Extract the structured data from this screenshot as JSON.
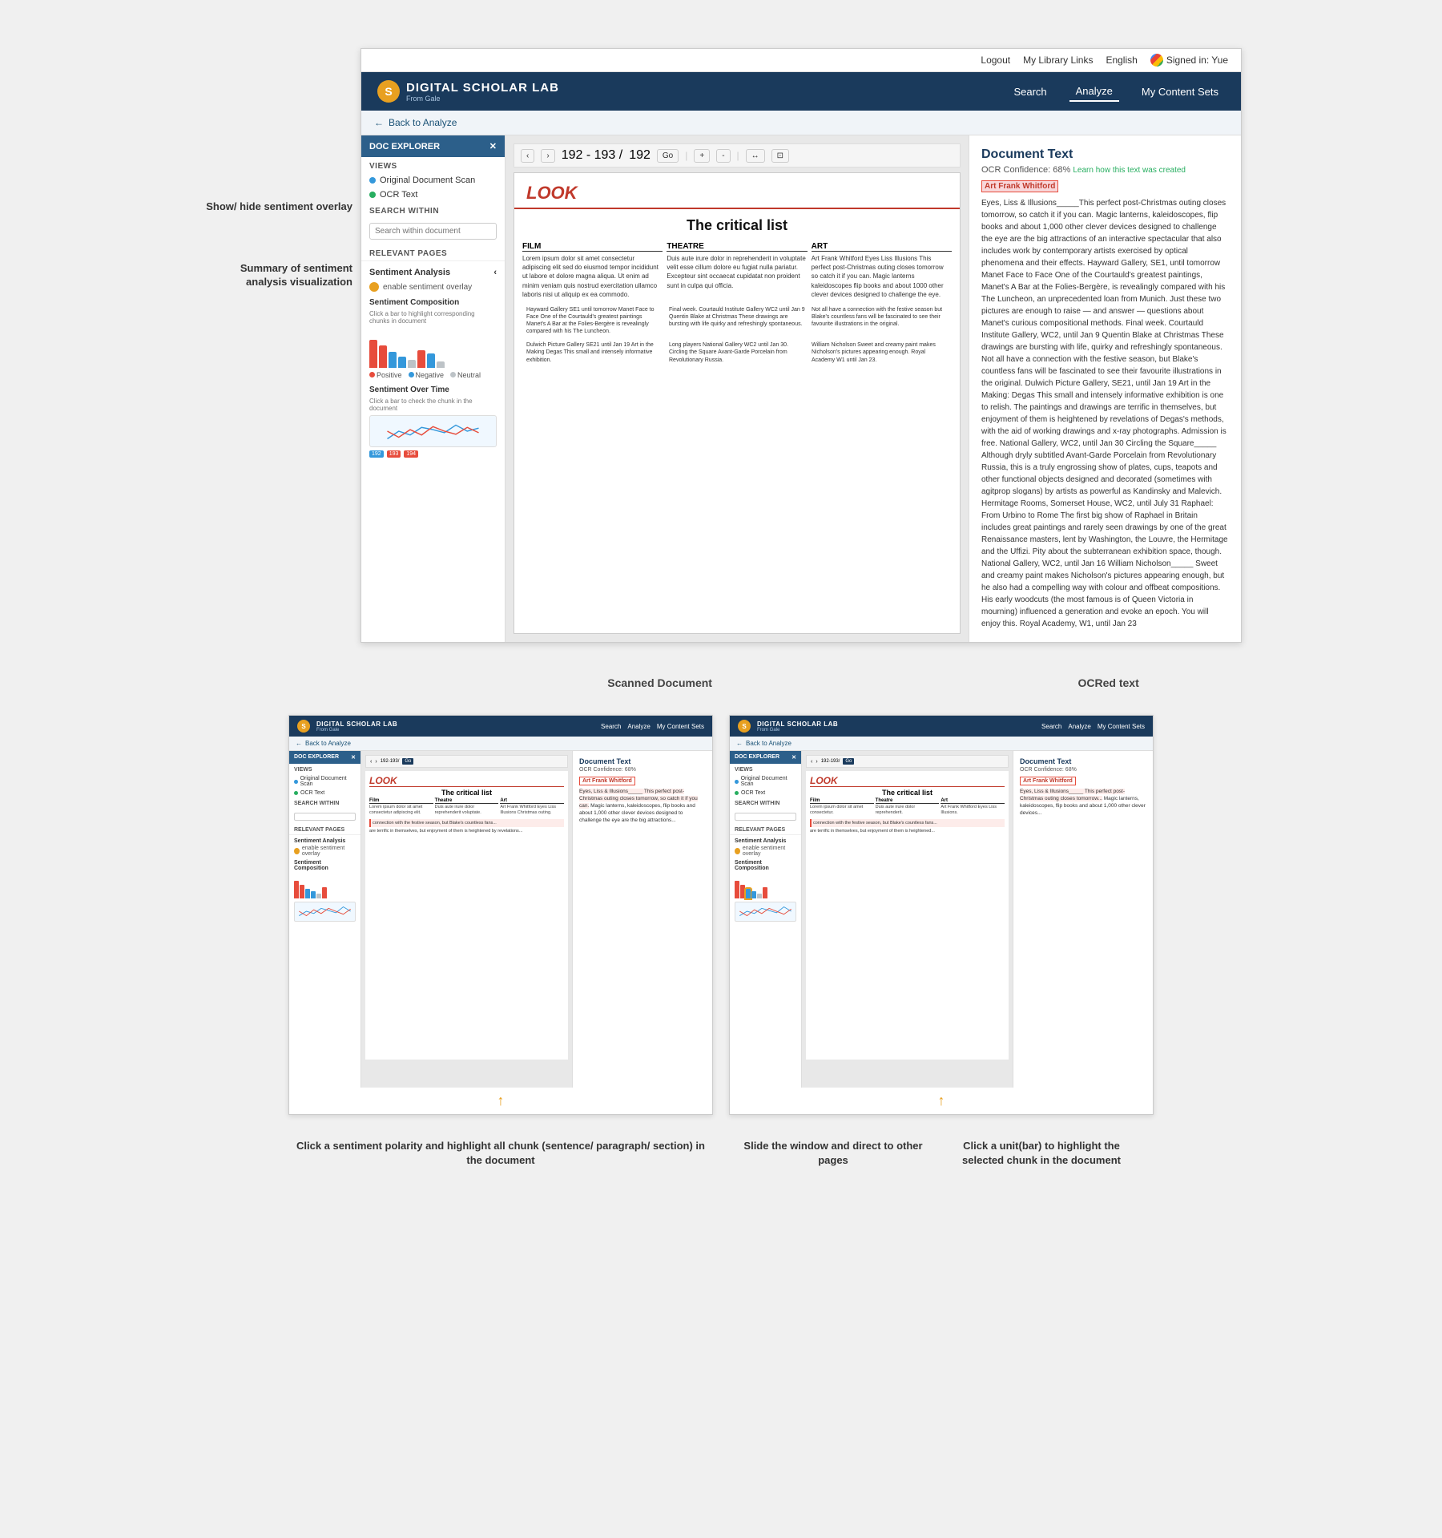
{
  "topNav": {
    "logout": "Logout",
    "myLibraryLinks": "My Library Links",
    "language": "English",
    "signedIn": "Signed in: Yue"
  },
  "header": {
    "logoIcon": "S",
    "logoTitle": "DIGITAL SCHOLAR LAB",
    "logoSubtitle": "From Gale",
    "nav": {
      "search": "Search",
      "analyze": "Analyze",
      "myContentSets": "My Content Sets"
    }
  },
  "docExplorer": {
    "title": "DOC EXPLORER",
    "backLabel": "Back to Analyze",
    "views": {
      "sectionTitle": "VIEWS",
      "originalScan": "Original Document Scan",
      "ocrText": "OCR Text"
    },
    "searchWithin": {
      "label": "SEARCH WITHIN",
      "placeholder": "Search within document"
    },
    "relevantPages": "RELEVANT PAGES",
    "sentimentAnalysis": {
      "title": "Sentiment Analysis",
      "enableOverlay": "enable sentiment overlay",
      "compositionTitle": "Sentiment Composition",
      "compositionSubtext": "Click a bar to highlight corresponding chunks in document",
      "overTimeTitle": "Sentiment Over Time",
      "overTimeSubtext": "Click a bar to check the chunk in the document"
    }
  },
  "toolbar": {
    "pageRange": "192 - 193 /",
    "currentPage": "192",
    "goButton": "Go",
    "zoomIn": "+",
    "zoomOut": "-",
    "fitWidth": "↔",
    "fitPage": "⊡"
  },
  "documentContent": {
    "logoText": "LOOK",
    "title": "The critical list",
    "columns": {
      "film": "Film",
      "theatre": "Theatre",
      "art": "Art"
    }
  },
  "ocrPanel": {
    "title": "Document Text",
    "confidence": "OCR Confidence: 68%",
    "learnLink": "Learn how this text was created",
    "highlightedName": "Art Frank Whitford",
    "textContent": "Eyes, Liss & Illusions_____This perfect post-Christmas outing closes tomorrow, so catch it if you can. Magic lanterns, kaleidoscopes, flip books and about 1,000 other clever devices designed to challenge the eye are the big attractions of an interactive spectacular that also includes work by contemporary artists exercised by optical phenomena and their effects. Hayward Gallery, SE1, until tomorrow Manet Face to Face One of the Courtauld's greatest paintings, Manet's A Bar at the Folies-Bergère, is revealingly compared with his The Luncheon, an unprecedented loan from Munich. Just these two pictures are enough to raise — and answer — questions about Manet's curious compositional methods. Final week. Courtauld Institute Gallery, WC2, until Jan 9 Quentin Blake at Christmas These drawings are bursting with life, quirky and refreshingly spontaneous. Not all have a connection with the festive season, but Blake's countless fans will be fascinated to see their favourite illustrations in the original. Dulwich Picture Gallery, SE21, until Jan 19 Art in the Making: Degas This small and intensely informative exhibition is one to relish. The paintings and drawings are terrific in themselves, but enjoyment of them is heightened by revelations of Degas's methods, with the aid of working drawings and x-ray photographs. Admission is free. National Gallery, WC2, until Jan 30 Circling the Square_____ Although dryly subtitled Avant-Garde Porcelain from Revolutionary Russia, this is a truly engrossing show of plates, cups, teapots and other functional objects designed and decorated (sometimes with agitprop slogans) by artists as powerful as Kandinsky and Malevich. Hermitage Rooms, Somerset House, WC2, until July 31 Raphael: From Urbino to Rome The first big show of Raphael in Britain includes great paintings and rarely seen drawings by one of the great Renaissance masters, lent by Washington, the Louvre, the Hermitage and the Uffizi. Pity about the subterranean exhibition space, though. National Gallery, WC2, until Jan 16 William Nicholson_____ Sweet and creamy paint makes Nicholson's pictures appearing enough, but he also had a compelling way with colour and offbeat compositions. His early woodcuts (the most famous is of Queen Victoria in mourning) influenced a generation and evoke an epoch. You will enjoy this. Royal Academy, W1, until Jan 23"
  },
  "annotations": {
    "showHideSentimentOverlay": "Show/ hide\nsentiment overlay",
    "summaryVisualization": "Summary of\nsentiment analysis\nvisualization",
    "scannedDocument": "Scanned Document",
    "ocredText": "OCRed text"
  },
  "bottomScreenshots": {
    "left": {
      "annotation": "Click a sentiment polarity and highlight\nall chunk (sentence/ paragraph/ section)\nin the document",
      "arrowText": "↑"
    },
    "middle": {
      "annotation": "Slide the window and\ndirect to other pages",
      "arrowText": "↑"
    },
    "right": {
      "annotation": "Click a unit(bar) to\nhighlight the selected\nchunk in the document",
      "arrowText": "↑"
    }
  },
  "colors": {
    "positive": "#e74c3c",
    "negative": "#3498db",
    "neutral": "#bdc3c7",
    "orange": "#e8a020",
    "headerBg": "#1a3a5c",
    "panelBg": "#2c5f8a"
  }
}
